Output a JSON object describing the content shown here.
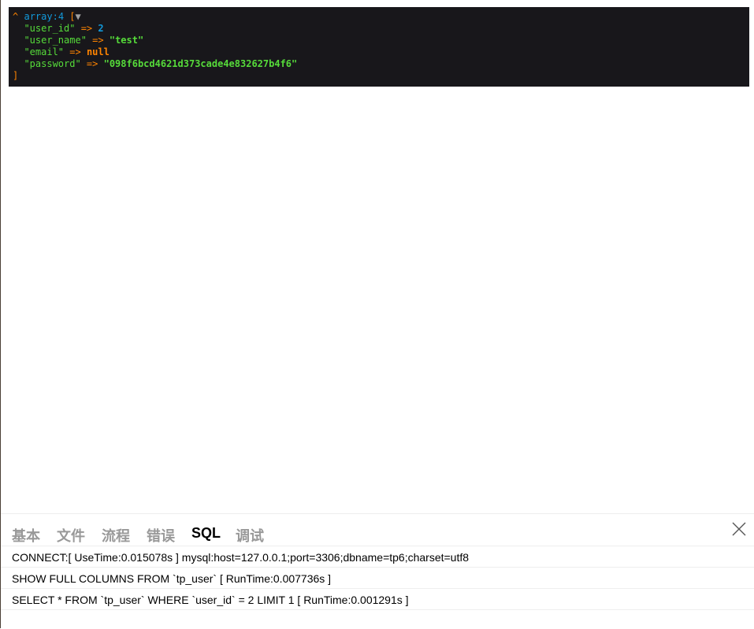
{
  "dump": {
    "caret": "^",
    "header": "array:4",
    "open": "[",
    "toggle": "▼",
    "close": "]",
    "items": [
      {
        "key": "\"user_id\"",
        "arrow": " => ",
        "value": "2",
        "type": "num"
      },
      {
        "key": "\"user_name\"",
        "arrow": " => ",
        "value": "\"test\"",
        "type": "str"
      },
      {
        "key": "\"email\"",
        "arrow": " => ",
        "value": "null",
        "type": "cst"
      },
      {
        "key": "\"password\"",
        "arrow": " => ",
        "value": "\"098f6bcd4621d373cade4e832627b4f6\"",
        "type": "str"
      }
    ]
  },
  "trace": {
    "tabs": [
      {
        "label": "基本"
      },
      {
        "label": "文件"
      },
      {
        "label": "流程"
      },
      {
        "label": "错误"
      },
      {
        "label": "SQL",
        "active": true
      },
      {
        "label": "调试"
      }
    ],
    "rows": [
      "CONNECT:[ UseTime:0.015078s ] mysql:host=127.0.0.1;port=3306;dbname=tp6;charset=utf8",
      "SHOW FULL COLUMNS FROM `tp_user` [ RunTime:0.007736s ]",
      "SELECT * FROM `tp_user` WHERE `user_id` = 2 LIMIT 1 [ RunTime:0.001291s ]"
    ]
  }
}
